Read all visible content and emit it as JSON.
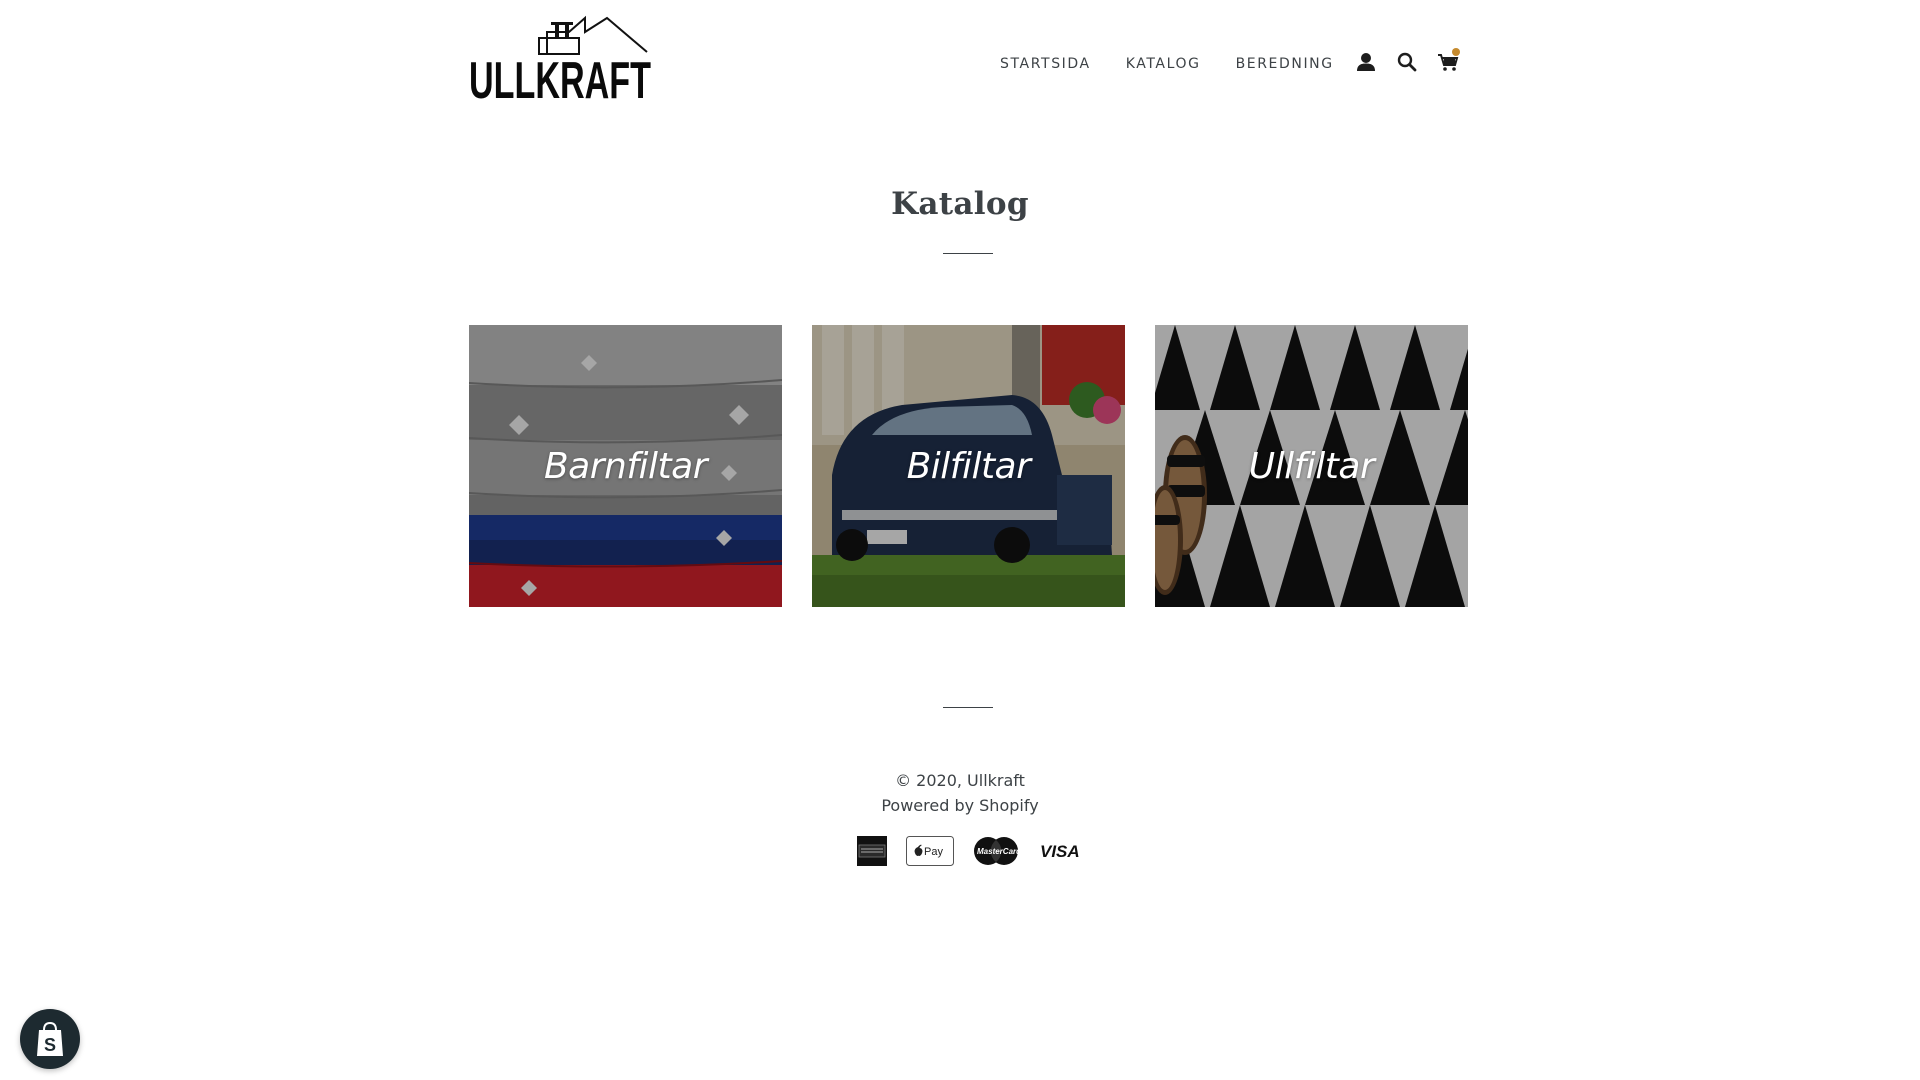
{
  "header": {
    "logo_text": "ULLKRAFT",
    "nav": [
      {
        "label": "STARTSIDA"
      },
      {
        "label": "KATALOG"
      },
      {
        "label": "BEREDNING"
      }
    ],
    "icons": [
      "account-icon",
      "search-icon",
      "cart-icon"
    ]
  },
  "main": {
    "title": "Katalog",
    "collections": [
      {
        "label": "Barnfiltar"
      },
      {
        "label": "Bilfiltar"
      },
      {
        "label": "Ullfiltar"
      }
    ]
  },
  "footer": {
    "copyright_prefix": "© 2020, ",
    "store_name": "Ullkraft",
    "powered_by": "Powered by Shopify",
    "payment_icons": [
      "american-express-icon",
      "apple-pay-icon",
      "mastercard-icon",
      "visa-icon"
    ]
  },
  "colors": {
    "text": "#3d4246",
    "accent_dot": "#c58a2e",
    "badge_bg": "#1d2a30"
  }
}
